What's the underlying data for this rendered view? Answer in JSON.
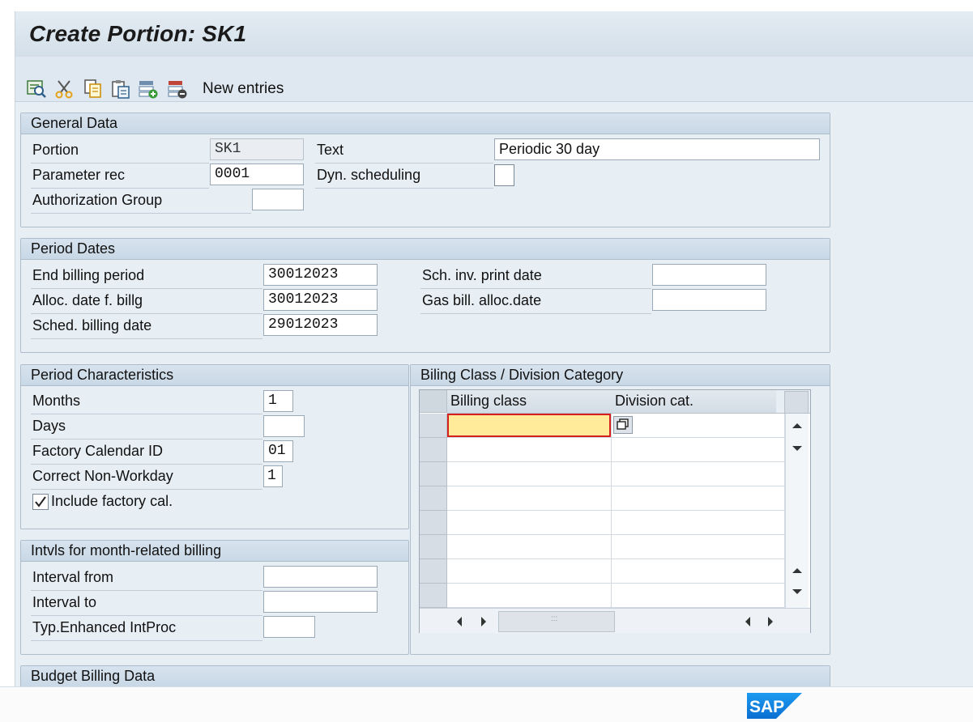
{
  "title": "Create Portion: SK1",
  "toolbar": {
    "buttons": [
      {
        "name": "details-icon"
      },
      {
        "name": "cut-icon"
      },
      {
        "name": "copy-icon"
      },
      {
        "name": "paste-icon"
      },
      {
        "name": "insert-row-icon"
      },
      {
        "name": "delete-row-icon"
      }
    ],
    "new_entries": "New entries"
  },
  "general": {
    "title": "General Data",
    "portion_label": "Portion",
    "portion_value": "SK1",
    "text_label": "Text",
    "text_value": "Periodic 30 day",
    "param_label": "Parameter rec",
    "param_value": "0001",
    "dyn_label": "Dyn. scheduling",
    "dyn_checked": false,
    "auth_label": "Authorization Group",
    "auth_value": ""
  },
  "period_dates": {
    "title": "Period Dates",
    "end_label": "End billing period",
    "end_value": "30012023",
    "alloc_label": "Alloc. date f. billg",
    "alloc_value": "30012023",
    "sched_label": "Sched. billing date",
    "sched_value": "29012023",
    "sch_inv_label": "Sch. inv. print date",
    "sch_inv_value": "",
    "gas_label": "Gas bill. alloc.date",
    "gas_value": ""
  },
  "period_chars": {
    "title": "Period Characteristics",
    "months_label": "Months",
    "months_value": "1",
    "days_label": "Days",
    "days_value": "",
    "calendar_label": "Factory Calendar ID",
    "calendar_value": "01",
    "nonwork_label": "Correct Non-Workday",
    "nonwork_value": "1",
    "include_label": "Include factory cal.",
    "include_checked": true
  },
  "intervals": {
    "title": "Intvls for month-related billing",
    "from_label": "Interval from",
    "from_value": "",
    "to_label": "Interval to",
    "to_value": "",
    "typ_label": "Typ.Enhanced IntProc",
    "typ_value": ""
  },
  "billing_class": {
    "title": "Biling Class / Division Category",
    "col_billing": "Billing class",
    "col_division": "Division cat.",
    "rows": 8
  },
  "budget": {
    "title": "Budget Billing Data"
  },
  "colors": {
    "frame_bg": "#e7eef4",
    "group_header": "#c9d8e6",
    "focused_cell": "#ffeb99",
    "focus_marker": "#d62020",
    "sap_logo": "#0a6ed1"
  }
}
